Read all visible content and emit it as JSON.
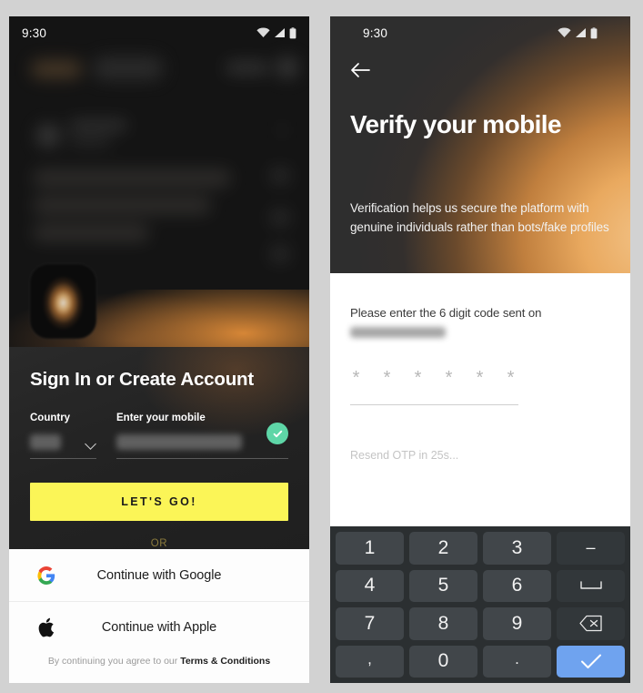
{
  "statusbar": {
    "time": "9:30",
    "wifi_icon": "wifi-icon",
    "signal_icon": "signal-icon",
    "battery_icon": "battery-icon"
  },
  "left_phone": {
    "background_feed": {
      "headline": "Who will be the next UK Prime Minister?",
      "blurred": true
    },
    "sheet": {
      "title": "Sign In or Create  Account",
      "country": {
        "label": "Country",
        "value": "",
        "value_redacted": true,
        "chevron_icon": "chevron-down-icon"
      },
      "mobile": {
        "label": "Enter your mobile",
        "value": "",
        "value_redacted": true,
        "valid_icon": "check-circle-icon"
      },
      "cta_label": "LET'S GO!",
      "cta_color": "#fbf557",
      "divider_label": "OR",
      "divider_color": "#8a7a3c",
      "sso": [
        {
          "icon": "google-icon",
          "label": "Continue with Google"
        },
        {
          "icon": "apple-icon",
          "label": "Continue with Apple"
        }
      ],
      "terms_prefix": "By continuing you agree to our ",
      "terms_link": "Terms & Conditions"
    }
  },
  "right_phone": {
    "back_icon": "arrow-left-icon",
    "title": "Verify your mobile",
    "description": "Verification helps us secure the platform with genuine individuals rather than bots/fake profiles",
    "otp_label": "Please enter the 6 digit code sent on",
    "otp_phone_value": "",
    "otp_phone_redacted": true,
    "otp_digits": [
      "*",
      "*",
      "*",
      "*",
      "*",
      "*"
    ],
    "resend_text": "Resend OTP in 25s...",
    "keypad": [
      {
        "label": "1",
        "name": "key-1",
        "type": "digit"
      },
      {
        "label": "2",
        "name": "key-2",
        "type": "digit"
      },
      {
        "label": "3",
        "name": "key-3",
        "type": "digit"
      },
      {
        "label": "–",
        "name": "key-minus",
        "type": "fn"
      },
      {
        "label": "4",
        "name": "key-4",
        "type": "digit"
      },
      {
        "label": "5",
        "name": "key-5",
        "type": "digit"
      },
      {
        "label": "6",
        "name": "key-6",
        "type": "digit"
      },
      {
        "label": "⌴",
        "name": "key-space",
        "type": "space"
      },
      {
        "label": "7",
        "name": "key-7",
        "type": "digit"
      },
      {
        "label": "8",
        "name": "key-8",
        "type": "digit"
      },
      {
        "label": "9",
        "name": "key-9",
        "type": "digit"
      },
      {
        "label": "",
        "name": "key-backspace",
        "type": "backspace"
      },
      {
        "label": ",",
        "name": "key-comma",
        "type": "small"
      },
      {
        "label": "0",
        "name": "key-0",
        "type": "digit"
      },
      {
        "label": ".",
        "name": "key-period",
        "type": "small"
      },
      {
        "label": "",
        "name": "key-enter",
        "type": "enter"
      }
    ],
    "enter_icon": "check-icon",
    "backspace_icon": "backspace-icon",
    "enter_color": "#6fa3ef"
  }
}
